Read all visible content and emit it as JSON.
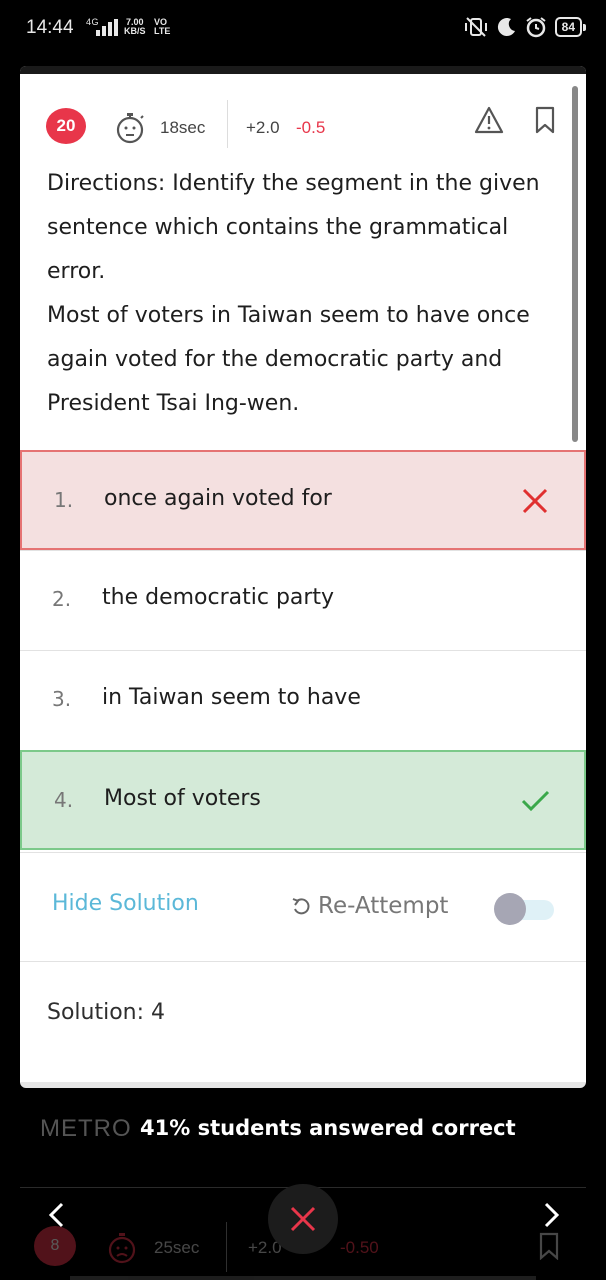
{
  "status_bar": {
    "time": "14:44",
    "network": "4G",
    "speed_value": "7.00",
    "speed_unit": "KB/S",
    "volte_top": "VO",
    "volte_bottom": "LTE",
    "battery": "84"
  },
  "question": {
    "number": "20",
    "time": "18sec",
    "positive_marks": "+2.0",
    "negative_marks": "-0.5",
    "directions": "Directions: Identify the segment in the given sentence which contains the grammatical error.",
    "sentence": "Most of voters in Taiwan seem to have once again voted for the democratic party and President Tsai Ing-wen."
  },
  "options": [
    {
      "num": "1.",
      "text": "once again voted for",
      "state": "wrong"
    },
    {
      "num": "2.",
      "text": "the democratic party",
      "state": "none"
    },
    {
      "num": "3.",
      "text": "in Taiwan seem to have",
      "state": "none"
    },
    {
      "num": "4.",
      "text": "Most of voters",
      "state": "correct"
    }
  ],
  "actions": {
    "hide_solution": "Hide Solution",
    "reattempt": "Re-Attempt",
    "reattempt_enabled": false
  },
  "solution": {
    "text": "Solution: 4"
  },
  "footer": {
    "watermark": "METRO",
    "stats": "41% students answered correct"
  },
  "next_question_preview": {
    "number": "8",
    "time": "25sec",
    "positive_marks": "+2.0",
    "negative_marks": "-0.50"
  },
  "colors": {
    "accent_red": "#e8364a",
    "wrong_bg": "#f4e0e0",
    "correct_bg": "#d4ead8",
    "link_blue": "#5bb8d8"
  }
}
